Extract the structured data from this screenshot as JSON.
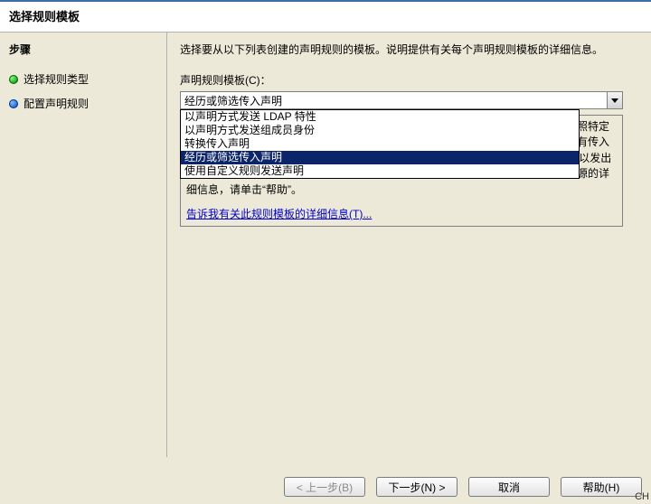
{
  "window": {
    "title": "选择规则模板"
  },
  "sidebar": {
    "heading": "步骤",
    "items": [
      {
        "label": "选择规则类型",
        "state": "done"
      },
      {
        "label": "配置声明规则",
        "state": "current"
      }
    ]
  },
  "main": {
    "intro": "选择要从以下列表创建的声明规则的模板。说明提供有关每个声明规则模板的详细信息。",
    "combo_label": "声明规则模板(C)：",
    "combo_value": "经历或筛选传入声明",
    "options": [
      "以声明方式发送 LDAP 特性",
      "以声明方式发送组成员身份",
      "转换传入声明",
      "经历或筛选传入声明",
      "使用自定义规则发送声明"
    ],
    "selected_index": 3,
    "description": "使用此规则模板，可只选择经历传入声明；或根据声明类型筛选传入声明。还可按照特定声明值筛选传入声明。例如，可以使用此规则模板创建一个规则，该规则将发送所有传入的组声明。还可以使用此规则仅发送以“@fabrikam”结尾的 UPN 声明。从此规则可以发出声明类型相同的多个声明。传入声明的源根据所编辑的规则而异。有关传入声明的源的详细信息，请单击“帮助”。",
    "link_text": "告诉我有关此规则模板的详细信息(T)..."
  },
  "buttons": {
    "back": "< 上一步(B)",
    "next": "下一步(N) >",
    "cancel": "取消",
    "help": "帮助(H)"
  },
  "corner": "CH"
}
